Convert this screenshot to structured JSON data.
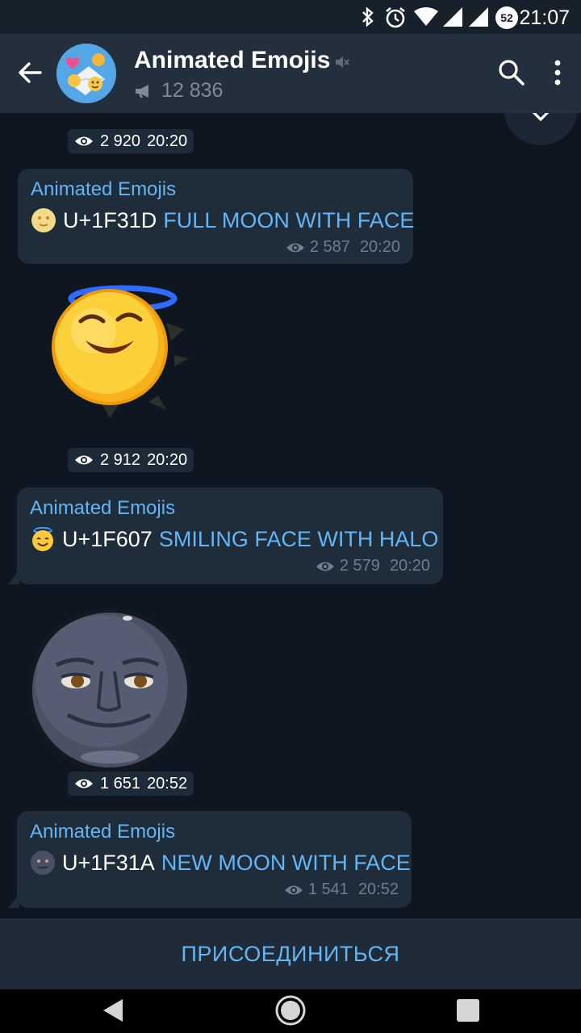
{
  "status_bar": {
    "time": "21:07",
    "battery_level": "52",
    "icons": [
      "bluetooth-icon",
      "alarm-icon",
      "wifi-icon",
      "signal-icon",
      "signal-icon",
      "battery-icon"
    ]
  },
  "header": {
    "title": "Animated Emojis",
    "subscribers": "12 836",
    "icons": [
      "back-arrow-icon",
      "muted-icon",
      "megaphone-icon",
      "search-icon",
      "more-vert-icon"
    ]
  },
  "messages": [
    {
      "type": "sticker-stats",
      "views": "2 920",
      "time": "20:20"
    },
    {
      "type": "text",
      "sender": "Animated Emojis",
      "code": "U+1F31D",
      "name": "FULL MOON WITH FACE",
      "views": "2 587",
      "time": "20:20",
      "emoji": "full-moon-face"
    },
    {
      "type": "sticker",
      "sticker": "smiling-face-with-halo",
      "views": "2 912",
      "time": "20:20"
    },
    {
      "type": "text",
      "sender": "Animated Emojis",
      "code": "U+1F607",
      "name": "SMILING FACE WITH HALO",
      "views": "2 579",
      "time": "20:20",
      "emoji": "smiling-face-with-halo"
    },
    {
      "type": "sticker",
      "sticker": "new-moon-with-face",
      "views": "1 651",
      "time": "20:52"
    },
    {
      "type": "text",
      "sender": "Animated Emojis",
      "code": "U+1F31A",
      "name": "NEW MOON WITH FACE",
      "views": "1 541",
      "time": "20:52",
      "emoji": "new-moon-face"
    }
  ],
  "join_button": "ПРИСОЕДИНИТЬСЯ",
  "colors": {
    "header_bg": "#242f3d",
    "chat_bg": "#0e1721",
    "bubble_bg": "#1f2c3a",
    "accent": "#64b5f6",
    "meta": "#6d7f8f"
  }
}
